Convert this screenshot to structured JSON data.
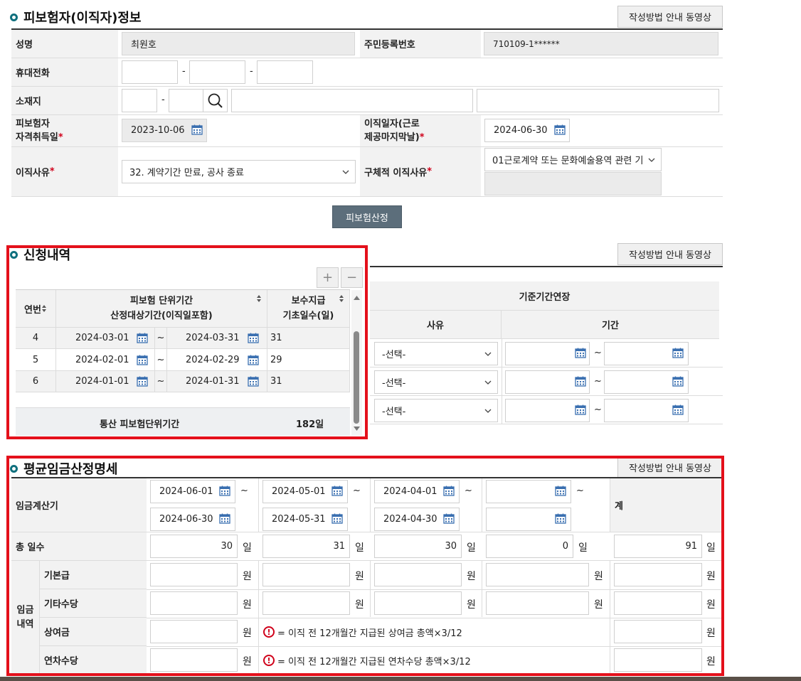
{
  "insured": {
    "title": "피보험자(이직자)정보",
    "guide_label": "작성방법 안내 동영상",
    "name_label": "성명",
    "name_value": "최원호",
    "rrn_label": "주민등록번호",
    "rrn_value": "710109-1******",
    "phone_label": "휴대전화",
    "phone_sep": "-",
    "addr_label": "소재지",
    "addr_sep": "-",
    "acquire_label_1": "피보험자",
    "acquire_label_2": "자격취득일",
    "acquire_value": "2023-10-06",
    "leave_label_1": "이직일자(근로",
    "leave_label_2": "제공마지막날)",
    "leave_value": "2024-06-30",
    "reason_label": "이직사유 ",
    "reason_value": "32. 계약기간 만료, 공사 종료",
    "detail_reason_label": "구체적 이직사유",
    "detail_reason_value": "01근로계약 또는 문화예술용역 관련 기",
    "required_mark": "*",
    "calc_button": "피보험산정"
  },
  "application": {
    "title": "신청내역",
    "guide_label": "작성방법 안내 동영상",
    "add_label": "+",
    "remove_label": "−",
    "col_no": "연번",
    "col_period_1": "피보험 단위기간",
    "col_period_2": "산정대상기간(이직일포함)",
    "col_days_1": "보수지급",
    "col_days_2": "기초일수(일)",
    "rows": [
      {
        "no": "4",
        "from": "2024-03-01",
        "to": "2024-03-31",
        "days": "31"
      },
      {
        "no": "5",
        "from": "2024-02-01",
        "to": "2024-02-29",
        "days": "29"
      },
      {
        "no": "6",
        "from": "2024-01-01",
        "to": "2024-01-31",
        "days": "31"
      }
    ],
    "tilde": "~",
    "total_label": "통산 피보험단위기간",
    "total_value": "182일",
    "ext_title": "기준기간연장",
    "ext_col_reason": "사유",
    "ext_col_period": "기간",
    "ext_select_label": "-선택-"
  },
  "wage": {
    "title": "평균임금산정명세",
    "guide_label": "작성방법 안내 동영상",
    "period_label": "임금계산기",
    "periods": [
      {
        "from": "2024-06-01",
        "to": "2024-06-30"
      },
      {
        "from": "2024-05-01",
        "to": "2024-05-31"
      },
      {
        "from": "2024-04-01",
        "to": "2024-04-30"
      },
      {
        "from": "",
        "to": ""
      }
    ],
    "tilde": "~",
    "total_col_label": "계",
    "days_label": "총 일수",
    "days_values": [
      "30",
      "31",
      "30",
      "0"
    ],
    "days_total": "91",
    "day_unit": "일",
    "won_unit": "원",
    "group_label_1": "임금",
    "group_label_2": "내역",
    "base_label": "기본급",
    "other_label": "기타수당",
    "bonus_label": "상여금",
    "annual_label": "연차수당",
    "bonus_note": "= 이직 전 12개월간 지급된 상여금 총액×3/12",
    "annual_note": "= 이직 전 12개월간 지급된 연차수당 총액×3/12",
    "warn_symbol": "!"
  },
  "colors": {
    "accent_teal": "#10707e",
    "highlight_red": "#e4101b",
    "button_dark": "#5c6e7b"
  }
}
